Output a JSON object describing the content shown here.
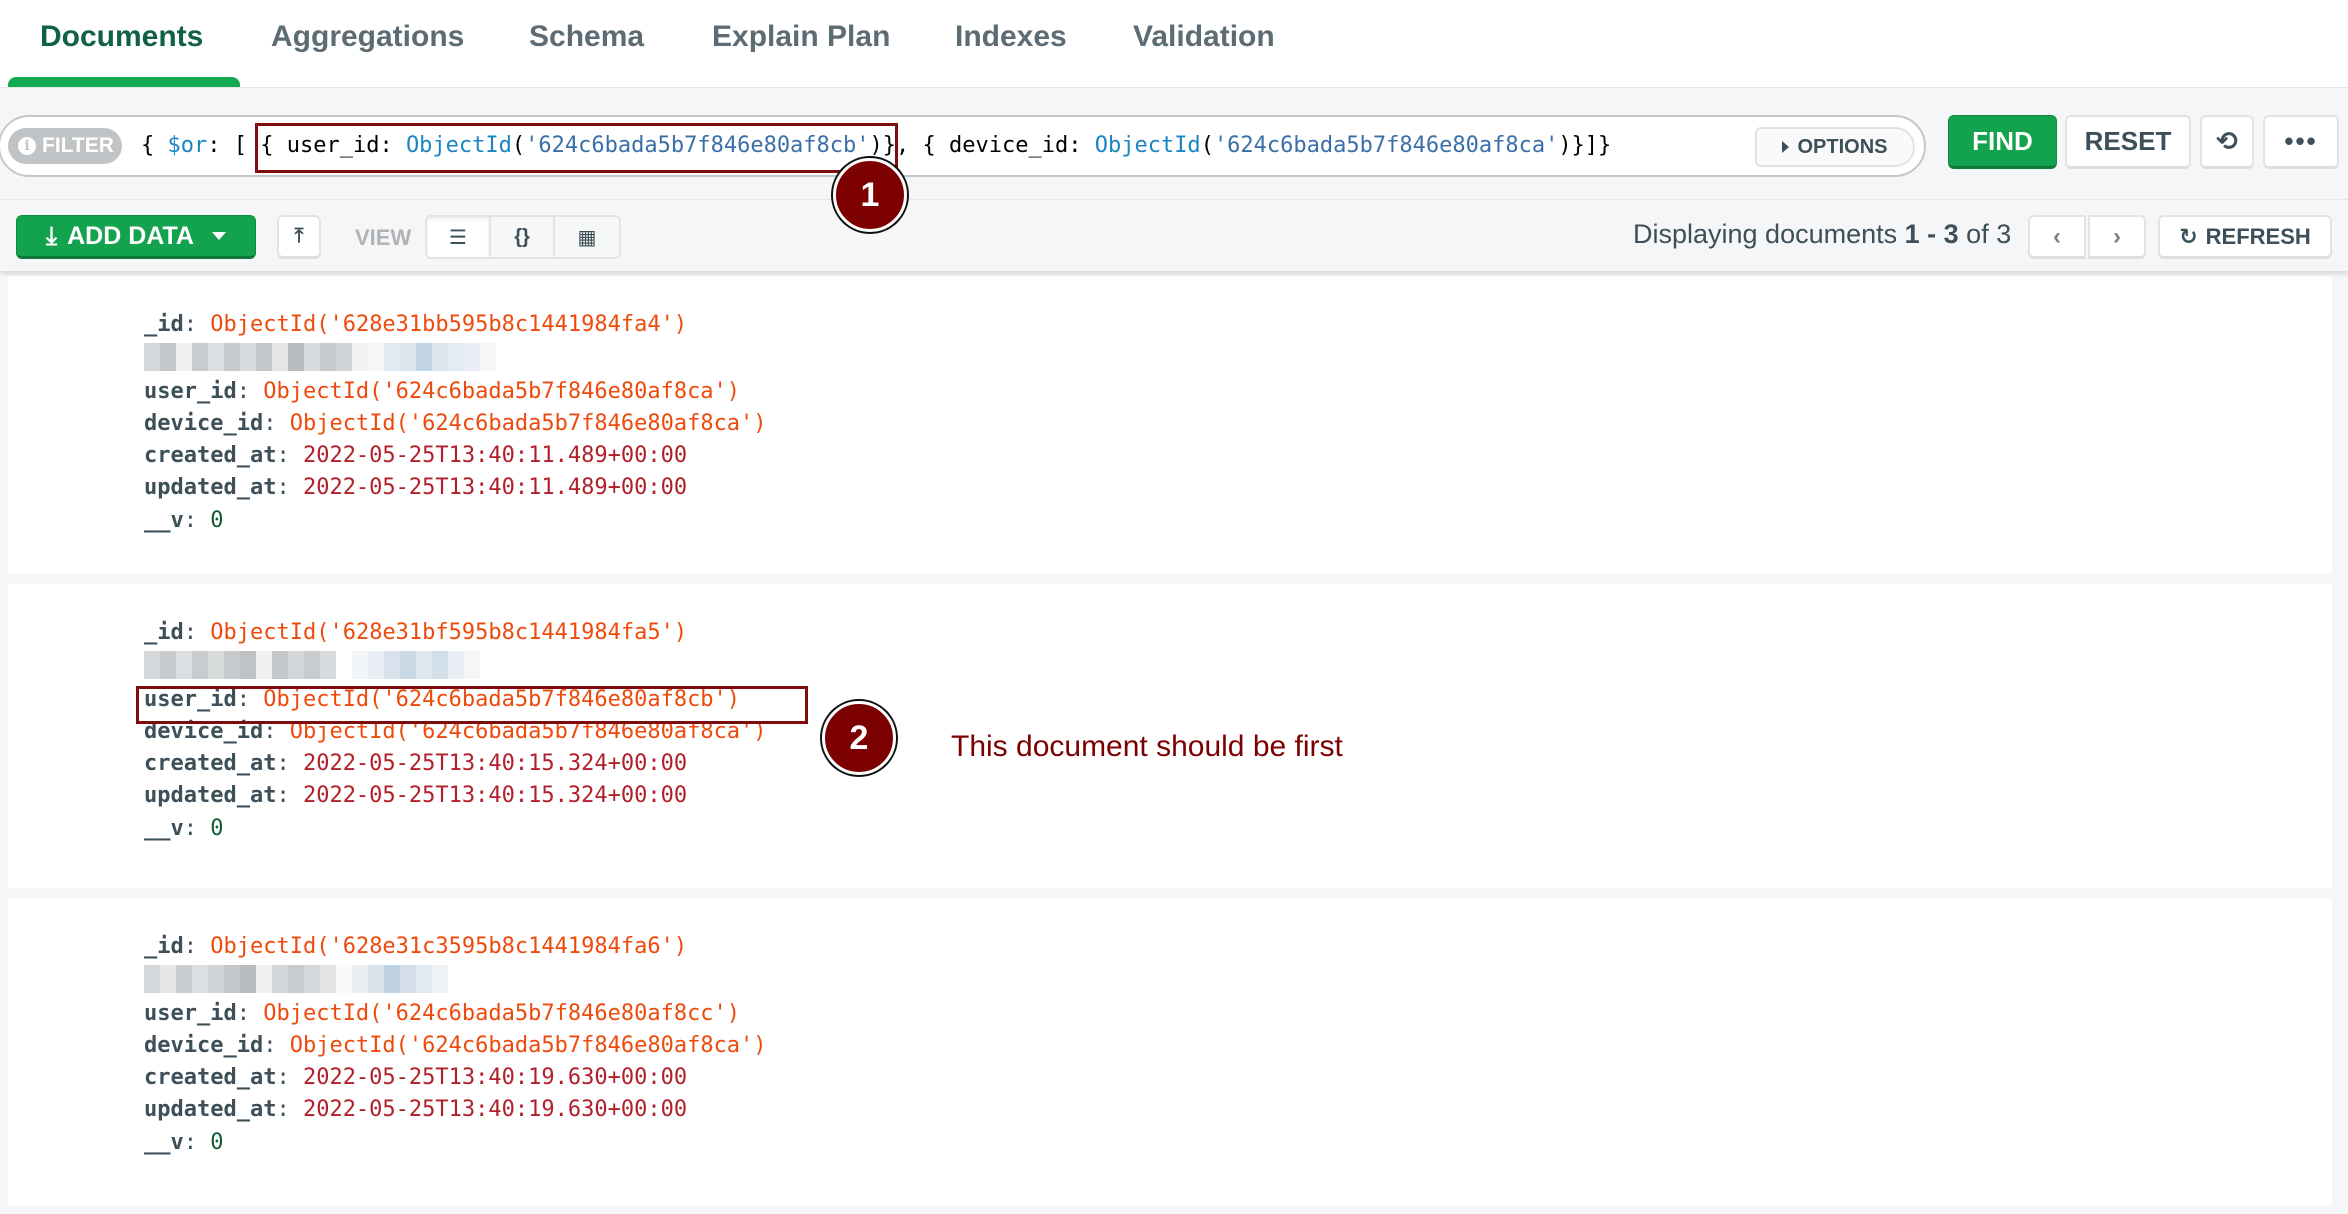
{
  "tabs": [
    {
      "label": "Documents",
      "active": true
    },
    {
      "label": "Aggregations",
      "active": false
    },
    {
      "label": "Schema",
      "active": false
    },
    {
      "label": "Explain Plan",
      "active": false
    },
    {
      "label": "Indexes",
      "active": false
    },
    {
      "label": "Validation",
      "active": false
    }
  ],
  "query": {
    "filter_label": "FILTER",
    "info_icon": "i",
    "parts": {
      "open": "{ ",
      "or_kw": "$or",
      "after_or": ": [ ",
      "clause1_open": "{ user_id: ",
      "clause1_fn": "ObjectId",
      "clause1_paren_open": "(",
      "clause1_str": "'624c6bada5b7f846e80af8cb'",
      "clause1_close": ")}",
      "sep": ", ",
      "clause2_open": "{ device_id: ",
      "clause2_fn": "ObjectId",
      "clause2_paren_open": "(",
      "clause2_str": "'624c6bada5b7f846e80af8ca'",
      "clause2_close": ")}]}"
    },
    "options_label": "OPTIONS",
    "find_label": "FIND",
    "reset_label": "RESET",
    "history_icon": "⟲",
    "more_icon": "•••"
  },
  "toolbar": {
    "add_data_label": "ADD DATA",
    "add_data_icon": "⤓",
    "upload_icon": "⤒",
    "view_label": "VIEW",
    "view_list_icon": "☰",
    "view_json_icon": "{}",
    "view_table_icon": "▦",
    "display_prefix": "Displaying documents ",
    "display_range": "1 - 3",
    "display_suffix": " of 3",
    "prev_icon": "‹",
    "next_icon": "›",
    "refresh_icon": "↻",
    "refresh_label": "REFRESH"
  },
  "documents": [
    {
      "_id": "ObjectId('628e31bb595b8c1441984fa4')",
      "user_id": "ObjectId('624c6bada5b7f846e80af8ca')",
      "device_id": "ObjectId('624c6bada5b7f846e80af8ca')",
      "created_at": "2022-05-25T13:40:11.489+00:00",
      "updated_at": "2022-05-25T13:40:11.489+00:00",
      "__v": "0"
    },
    {
      "_id": "ObjectId('628e31bf595b8c1441984fa5')",
      "user_id": "ObjectId('624c6bada5b7f846e80af8cb')",
      "device_id": "ObjectId('624c6bada5b7f846e80af8ca')",
      "created_at": "2022-05-25T13:40:15.324+00:00",
      "updated_at": "2022-05-25T13:40:15.324+00:00",
      "__v": "0"
    },
    {
      "_id": "ObjectId('628e31c3595b8c1441984fa6')",
      "user_id": "ObjectId('624c6bada5b7f846e80af8cc')",
      "device_id": "ObjectId('624c6bada5b7f846e80af8ca')",
      "created_at": "2022-05-25T13:40:19.630+00:00",
      "updated_at": "2022-05-25T13:40:19.630+00:00",
      "__v": "0"
    }
  ],
  "field_keys": {
    "_id": "_id",
    "user_id": "user_id",
    "device_id": "device_id",
    "created_at": "created_at",
    "updated_at": "updated_at",
    "__v": "__v"
  },
  "annotations": {
    "badge1": "1",
    "badge2": "2",
    "note": "This document should be first"
  },
  "colors": {
    "accent_green": "#13aa52",
    "active_tab_text": "#116149",
    "annotation": "#7d0000",
    "objectid_value": "#ee4a0c",
    "date_value": "#b1202a",
    "number_value": "#145a32"
  }
}
